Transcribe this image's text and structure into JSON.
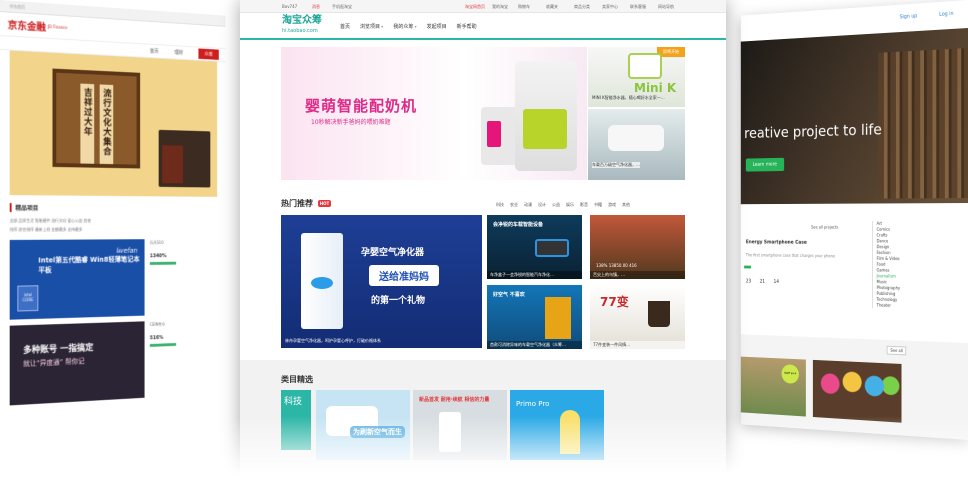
{
  "left_site": {
    "top_strip": "京东首页",
    "logo": "京东金融",
    "logo_sub": "JD Finance",
    "nav": [
      "首页",
      "理财",
      "众筹"
    ],
    "banner_text_cols": [
      "吉祥过大年",
      "流行文化大集合"
    ],
    "section_title": "精品项目",
    "filter_rows": [
      "全部  品质生活  智能硬件  流行文化  爱心公益  其他",
      "排序  综合排序  最新上线  金额最多  支持最多"
    ],
    "cards": [
      {
        "brand": "livefan",
        "headline": "Intel第五代酷睿 Win8轻薄笔记本平板",
        "badge": "intel CORE",
        "side_title": "乐凡S10",
        "pct": "1340%"
      },
      {
        "headline": "多种账号 一指搞定",
        "sub": "就让“异度通” 帮你记",
        "side_title": "CEIN传众",
        "pct": "516%"
      }
    ]
  },
  "right_site": {
    "sign_up": "Sign up",
    "log_in": "Log in",
    "hero_text": "reative project to life",
    "hero_button": "Learn more",
    "mid_label": "See all projects",
    "project_title": "Energy Smartphone Case",
    "project_sub": "The first smartphone case that charges your phone",
    "stats": [
      "23",
      "21",
      "14"
    ],
    "categories": [
      "Art",
      "Comics",
      "Crafts",
      "Dance",
      "Design",
      "Fashion",
      "Film & Video",
      "Food",
      "Games",
      "Journalism",
      "Music",
      "Photography",
      "Publishing",
      "Technology",
      "Theater"
    ],
    "active_category": "Journalism",
    "see_all": "See all",
    "sticker": "Staff pick"
  },
  "center_site": {
    "top_bar": {
      "left": "Bov747",
      "left2": "消息",
      "left3": "手机逛淘宝",
      "right": [
        "淘宝网首页",
        "我的淘宝",
        "购物车",
        "收藏夹",
        "商品分类",
        "卖家中心",
        "联系客服",
        "网站导航"
      ]
    },
    "logo_main": "淘宝众筹",
    "logo_sub": "hi.taobao.com",
    "nav": [
      "首页",
      "浏览项目",
      "我的众筹",
      "发起项目",
      "新手帮助"
    ],
    "banner": {
      "title": "婴萌智能配奶机",
      "subtitle": "10秒解决新手爸妈的喂奶难题"
    },
    "side_items": [
      {
        "caption": "MINI K智能净水器，随心喝好水全家一…",
        "logo_text": "Mini K",
        "tag": "即将开始"
      },
      {
        "caption": "车载百万级空气净化器，…"
      }
    ],
    "hot_section": {
      "title": "热门推荐",
      "badge": "HOT",
      "tabs": [
        "科技",
        "农业",
        "动漫",
        "设计",
        "公益",
        "娱乐",
        "影音",
        "书籍",
        "游戏",
        "其他"
      ]
    },
    "hot_items": [
      {
        "headline": "孕婴空气净化器",
        "mid": "送给准妈妈",
        "bottom": "的第一个礼物",
        "caption": "林舟孕婴空气净化器，呵护孕婴心呼护，打破价格体系"
      },
      {
        "headline": "会净锐的车载智能设备",
        "caption": "车净盒子—会净锐的智能汽车净化…"
      },
      {
        "headline": "138% 13850.00 416",
        "caption": "舌尖上的乌镇，…"
      },
      {
        "headline": "好空气 不喜欢",
        "caption": "首款可消除异味的车载空气净化器（众筹…"
      },
      {
        "headline": "77变",
        "caption": "77件变装一件风情…"
      }
    ],
    "category_section": {
      "title": "类目精选",
      "cat_label": "科技"
    },
    "category_items": [
      {
        "text": "为刷新空气而生"
      },
      {
        "text": "新品首发 耐用·续航 相信的力量"
      },
      {
        "text": "Primo Pro"
      }
    ]
  }
}
